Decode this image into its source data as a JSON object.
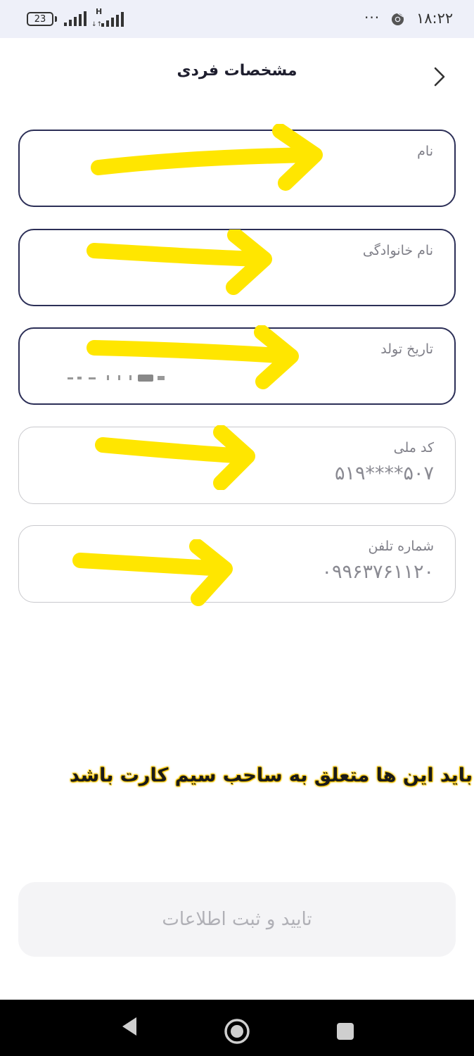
{
  "status_bar": {
    "battery_level": "23",
    "network_type": "H",
    "menu_dots": "···",
    "clock": "۱۸:۲۲",
    "icons": [
      "battery-icon",
      "signal-icon",
      "signal-h-icon",
      "more-dots-icon",
      "chrome-icon"
    ]
  },
  "header": {
    "title": "مشخصات فردی",
    "back_icon": "chevron-right-icon"
  },
  "fields": [
    {
      "label": "نام",
      "value": "",
      "enabled": true
    },
    {
      "label": "نام خانوادگی",
      "value": "",
      "enabled": true
    },
    {
      "label": "تاریخ تولد",
      "value": "",
      "enabled": true
    },
    {
      "label": "کد ملی",
      "value": "۵۱۹****۵۰۷",
      "enabled": false
    },
    {
      "label": "شماره تلفن",
      "value": "۰۹۹۶۳۷۶۱۱۲۰",
      "enabled": false
    }
  ],
  "annotation": {
    "text": "باید این ها متعلق به ساحب سیم کارت باشد",
    "highlight_color": "#f5c400",
    "arrow_color": "#ffe600"
  },
  "submit": {
    "label": "تایید و ثبت اطلاعات",
    "enabled": false
  },
  "nav_bar": {
    "icons": [
      "back-triangle-icon",
      "home-circle-icon",
      "recents-square-icon"
    ]
  },
  "colors": {
    "field_border_active": "#2c2f57",
    "field_border_disabled": "#c9c9cd",
    "status_bar_bg": "#eef0f9"
  }
}
